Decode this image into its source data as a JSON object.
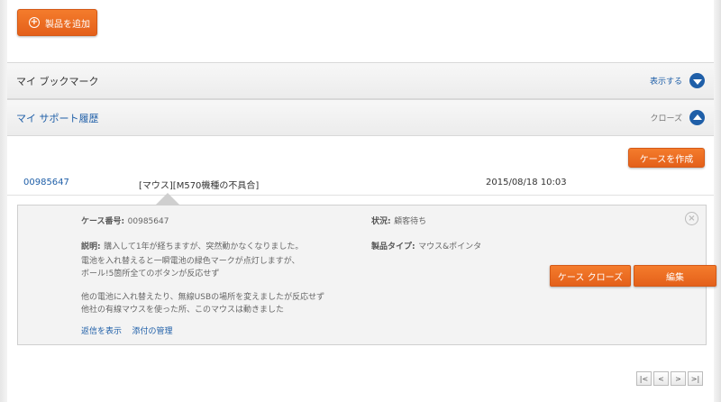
{
  "toolbar": {
    "add_product_label": "製品を追加",
    "add_product_icon": "plus-circle-icon"
  },
  "bookmarks": {
    "title": "マイ ブックマーク",
    "action_label": "表示する",
    "action_icon": "chevron-down-circle-icon"
  },
  "history": {
    "title": "マイ サポート履歴",
    "action_label": "クローズ",
    "action_icon": "chevron-up-circle-icon"
  },
  "create_case_label": "ケースを作成",
  "case": {
    "number": "00985647",
    "subject": "[マウス][M570機種の不具合]",
    "date": "2015/08/18 10:03",
    "detail": {
      "case_number_label": "ケース番号:",
      "case_number_value": "00985647",
      "status_label": "状況:",
      "status_value": "顧客待ち",
      "description_label": "説明:",
      "description_lines": [
        "購入して1年が経ちますが、突然動かなくなりました。",
        "電池を入れ替えると一瞬電池の緑色マークが点灯しますが、",
        "ボール!5箇所全てのボタンが反応せず",
        "",
        "他の電池に入れ替えたり、無線USBの場所を変えましたが反応せず",
        "他社の有線マウスを使った所、このマウスは動きました"
      ],
      "product_type_label": "製品タイプ:",
      "product_type_value": "マウス&ポインタ",
      "close_case_label": "ケース クローズ",
      "edit_label": "編集",
      "show_reply_link": "返信を表示",
      "manage_attachments_link": "添付の管理"
    }
  },
  "pagination": {
    "first": "|<",
    "prev": "<",
    "next": ">",
    "last": ">|"
  },
  "colors": {
    "accent_orange": "#f06a22",
    "link_blue": "#1f5fa8"
  }
}
